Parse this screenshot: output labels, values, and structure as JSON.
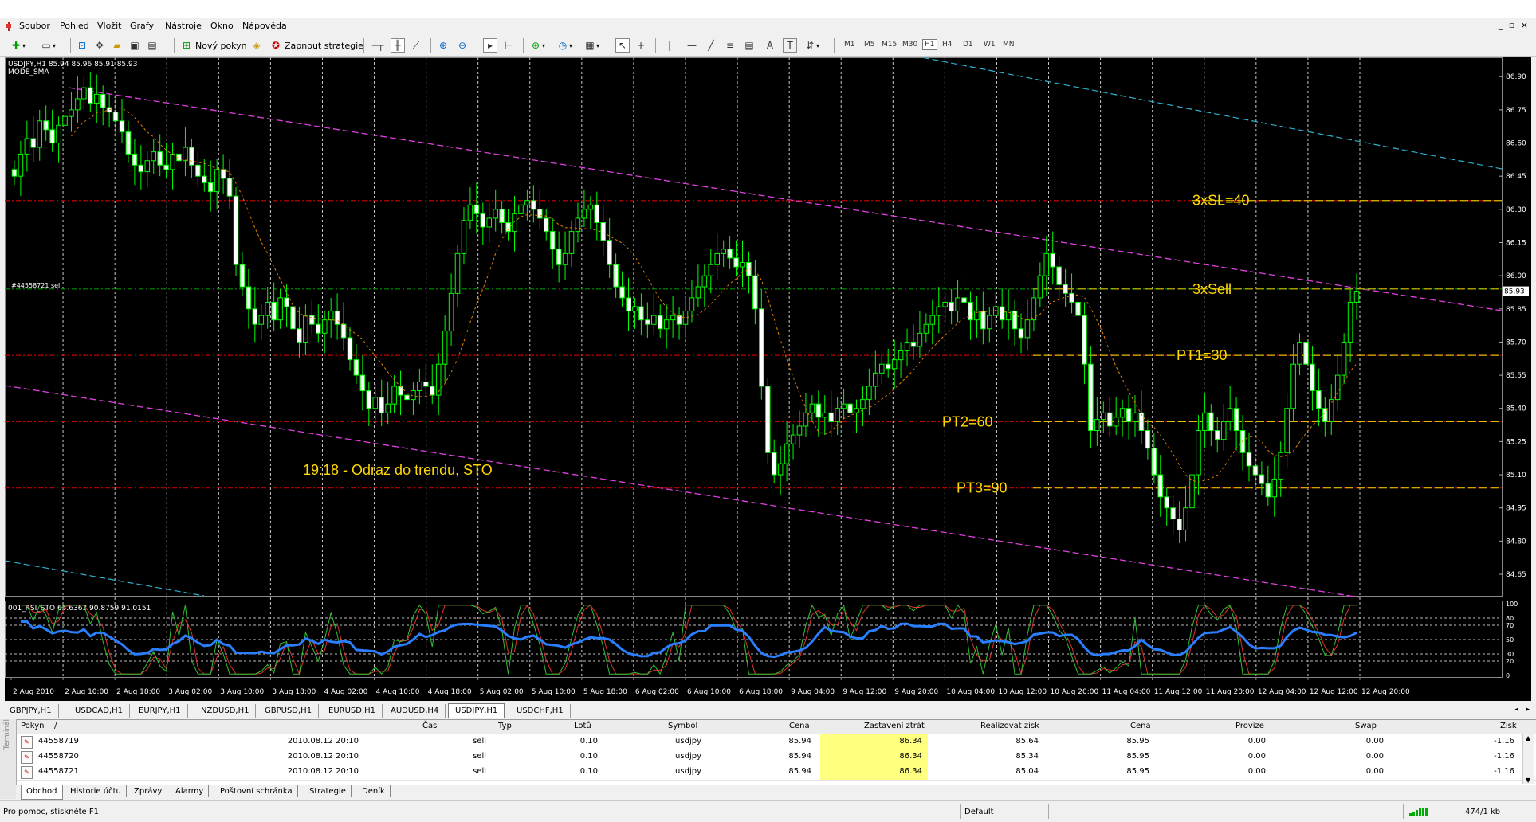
{
  "menu": [
    "Soubor",
    "Pohled",
    "Vložit",
    "Grafy",
    "Nástroje",
    "Okno",
    "Nápověda"
  ],
  "window_controls": "_ ▫ ×",
  "toolbar": {
    "new_order": "Nový pokyn",
    "strategies": "Zapnout strategie",
    "line_tools": [
      "↖",
      "+",
      "|",
      "—",
      "╱",
      "≡",
      "A",
      "T"
    ],
    "timeframes": [
      "M1",
      "M5",
      "M15",
      "M30",
      "H1",
      "H4",
      "D1",
      "W1",
      "MN"
    ],
    "active_timeframe": "H1"
  },
  "chart_data": {
    "type": "candlestick",
    "symbol_info": "USDJPY,H1  85.94 85.96 85.91 85.93",
    "indicator_label": "MODE_SMA",
    "ylim": [
      84.56,
      86.98
    ],
    "y_ticks": [
      "86.90",
      "86.75",
      "86.60",
      "86.45",
      "86.30",
      "86.15",
      "86.00",
      "85.85",
      "85.70",
      "85.55",
      "85.40",
      "85.25",
      "85.10",
      "84.95",
      "84.80",
      "84.65"
    ],
    "current_price": "85.93",
    "x_ticks": [
      "2 Aug 2010",
      "2 Aug 10:00",
      "2 Aug 18:00",
      "3 Aug 02:00",
      "3 Aug 10:00",
      "3 Aug 18:00",
      "4 Aug 02:00",
      "4 Aug 10:00",
      "4 Aug 18:00",
      "5 Aug 02:00",
      "5 Aug 10:00",
      "5 Aug 18:00",
      "6 Aug 02:00",
      "6 Aug 10:00",
      "6 Aug 18:00",
      "9 Aug 04:00",
      "9 Aug 12:00",
      "9 Aug 20:00",
      "10 Aug 04:00",
      "10 Aug 12:00",
      "10 Aug 20:00",
      "11 Aug 04:00",
      "11 Aug 12:00",
      "11 Aug 20:00",
      "12 Aug 04:00",
      "12 Aug 12:00",
      "12 Aug 20:00"
    ],
    "closes": [
      86.45,
      86.55,
      86.62,
      86.58,
      86.7,
      86.66,
      86.6,
      86.68,
      86.72,
      86.75,
      86.8,
      86.85,
      86.78,
      86.82,
      86.76,
      86.74,
      86.7,
      86.65,
      86.55,
      86.5,
      86.47,
      86.52,
      86.56,
      86.5,
      86.48,
      86.55,
      86.52,
      86.58,
      86.5,
      86.45,
      86.42,
      86.38,
      86.48,
      86.44,
      86.36,
      86.05,
      85.95,
      85.85,
      85.78,
      85.82,
      85.88,
      85.8,
      85.9,
      85.86,
      85.76,
      85.7,
      85.82,
      85.78,
      85.74,
      85.8,
      85.84,
      85.78,
      85.72,
      85.62,
      85.55,
      85.48,
      85.4,
      85.45,
      85.38,
      85.42,
      85.5,
      85.46,
      85.44,
      85.48,
      85.52,
      85.5,
      85.46,
      85.6,
      85.75,
      85.92,
      86.1,
      86.25,
      86.32,
      86.28,
      86.22,
      86.26,
      86.3,
      86.24,
      86.2,
      86.28,
      86.32,
      86.34,
      86.3,
      86.26,
      86.2,
      86.12,
      86.05,
      86.1,
      86.2,
      86.26,
      86.3,
      86.32,
      86.24,
      86.16,
      86.05,
      85.95,
      85.9,
      85.84,
      85.86,
      85.8,
      85.78,
      85.82,
      85.76,
      85.8,
      85.82,
      85.78,
      85.84,
      85.9,
      85.95,
      86.0,
      86.05,
      86.1,
      86.12,
      86.08,
      86.04,
      86.06,
      86.0,
      85.85,
      85.5,
      85.2,
      85.1,
      85.15,
      85.24,
      85.28,
      85.32,
      85.38,
      85.42,
      85.36,
      85.38,
      85.34,
      85.4,
      85.42,
      85.38,
      85.4,
      85.44,
      85.5,
      85.56,
      85.6,
      85.58,
      85.62,
      85.66,
      85.7,
      85.68,
      85.74,
      85.78,
      85.82,
      85.86,
      85.88,
      85.84,
      85.9,
      85.88,
      85.8,
      85.84,
      85.76,
      85.82,
      85.86,
      85.8,
      85.84,
      85.76,
      85.72,
      85.8,
      85.9,
      86.0,
      86.1,
      86.04,
      85.96,
      85.92,
      85.88,
      85.82,
      85.6,
      85.3,
      85.35,
      85.38,
      85.32,
      85.36,
      85.4,
      85.34,
      85.38,
      85.3,
      85.22,
      85.1,
      85.0,
      84.95,
      84.9,
      84.85,
      84.95,
      85.1,
      85.3,
      85.38,
      85.3,
      85.26,
      85.34,
      85.4,
      85.3,
      85.2,
      85.14,
      85.1,
      85.06,
      85.0,
      85.08,
      85.2,
      85.4,
      85.6,
      85.7,
      85.6,
      85.48,
      85.4,
      85.34,
      85.44,
      85.55,
      85.7,
      85.88,
      85.93
    ],
    "sma_period": 10,
    "levels": [
      {
        "price": 86.34,
        "color": "#c00000",
        "label": "3xSL=40"
      },
      {
        "price": 85.94,
        "color": "#009000",
        "label": "3xSell"
      },
      {
        "price": 85.64,
        "color": "#c00000",
        "label": "PT1=30"
      },
      {
        "price": 85.34,
        "color": "#c00000",
        "label": "PT2=60"
      },
      {
        "price": 85.04,
        "color": "#c00000",
        "label": "PT3=90"
      }
    ],
    "order_label": "#44558721 sell",
    "annotation": "19:18 - Odraz do trendu, STO",
    "channel_color": "#e040e0",
    "outer_channel_color": "#30b0d0",
    "candle_color": "#00ff00",
    "sma_color": "#e08000",
    "oscillator": {
      "label": "001_RSI_STO 65.6363 90.8759 91.0151",
      "ylim": [
        0,
        100
      ],
      "y_ticks": [
        "100",
        "80",
        "70",
        "50",
        "30",
        "20",
        "0"
      ]
    }
  },
  "symbol_tabs": [
    "GBPJPY,H1",
    "USDCAD,H1",
    "EURJPY,H1",
    "NZDUSD,H1",
    "GBPUSD,H1",
    "EURUSD,H1",
    "AUDUSD,H4",
    "USDJPY,H1",
    "USDCHF,H1"
  ],
  "active_symbol_tab": "USDJPY,H1",
  "terminal": {
    "side_label": "Terminál",
    "columns": [
      "Pokyn",
      "/",
      "Čas",
      "Typ",
      "Lotů",
      "Symbol",
      "Cena",
      "Zastavení ztrát",
      "Realizovat zisk",
      "Cena",
      "Provize",
      "Swap",
      "Zisk"
    ],
    "rows": [
      {
        "order": "44558719",
        "time": "2010.08.12 20:10",
        "type": "sell",
        "lots": "0.10",
        "symbol": "usdjpy",
        "price": "85.94",
        "sl": "86.34",
        "tp": "85.64",
        "cur": "85.95",
        "comm": "0.00",
        "swap": "0.00",
        "profit": "-1.16"
      },
      {
        "order": "44558720",
        "time": "2010.08.12 20:10",
        "type": "sell",
        "lots": "0.10",
        "symbol": "usdjpy",
        "price": "85.94",
        "sl": "86.34",
        "tp": "85.34",
        "cur": "85.95",
        "comm": "0.00",
        "swap": "0.00",
        "profit": "-1.16"
      },
      {
        "order": "44558721",
        "time": "2010.08.12 20:10",
        "type": "sell",
        "lots": "0.10",
        "symbol": "usdjpy",
        "price": "85.94",
        "sl": "86.34",
        "tp": "85.04",
        "cur": "85.95",
        "comm": "0.00",
        "swap": "0.00",
        "profit": "-1.16"
      }
    ],
    "tabs": [
      "Obchod",
      "Historie účtu",
      "Zprávy",
      "Alarmy",
      "Poštovní schránka",
      "Strategie",
      "Deník"
    ],
    "active_tab": "Obchod"
  },
  "status": {
    "help": "Pro pomoc, stiskněte F1",
    "profile": "Default",
    "traffic": "474/1 kb"
  }
}
